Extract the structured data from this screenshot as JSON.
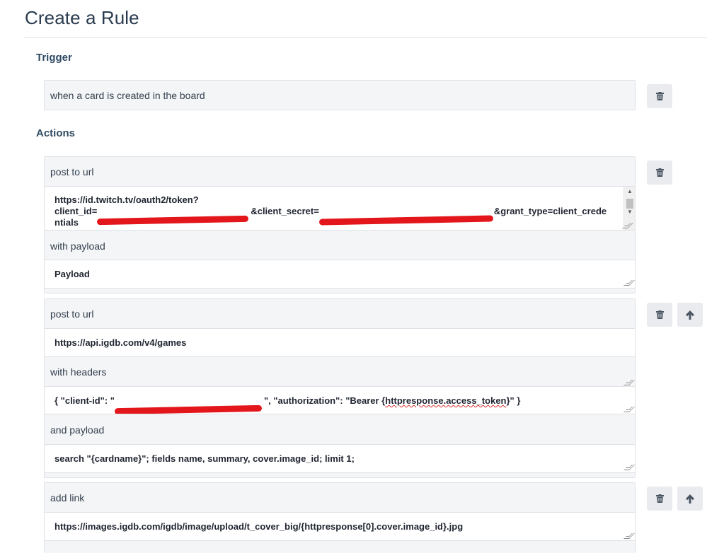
{
  "page": {
    "title": "Create a Rule"
  },
  "trigger": {
    "heading": "Trigger",
    "value": "when a card is created in the board",
    "delete_icon": "trash-icon"
  },
  "actions": {
    "heading": "Actions",
    "items": [
      {
        "label": "post to url",
        "url_line1": "https://id.twitch.tv/oauth2/token?",
        "url_line2_a": "client_id=",
        "url_line2_b": "&client_secret=",
        "url_line2_c": "&grant_type=client_crede",
        "url_line3": "ntials",
        "payload_label": "with payload",
        "payload_value": "Payload"
      },
      {
        "label": "post to url",
        "url": "https://api.igdb.com/v4/games",
        "headers_label": "with headers",
        "headers_a": "{ \"client-id\": \"",
        "headers_b": "\", \"authorization\": \"Bearer {",
        "headers_c": "httpresponse.access_token",
        "headers_d": "}\" }",
        "payload_label": "and payload",
        "payload_value": "search \"{cardname}\"; fields name, summary, cover.image_id; limit 1;"
      },
      {
        "label": "add link",
        "url": "https://images.igdb.com/igdb/image/upload/t_cover_big/{httpresponse[0].cover.image_id}.jpg"
      }
    ]
  },
  "icons": {
    "delete": "trash-icon",
    "move_up": "arrow-up-icon"
  }
}
